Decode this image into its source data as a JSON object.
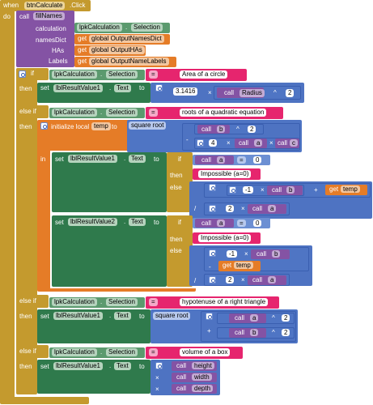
{
  "event": {
    "when": "when",
    "component": "btnCalculate",
    "event": ".Click",
    "do": "do"
  },
  "callFill": {
    "call": "call",
    "proc": "fillNames",
    "params": [
      "calculation",
      "namesDict",
      "HAs",
      "Labels"
    ],
    "calcComponent": "lpkCalculation",
    "calcProp": "Selection",
    "get": "get",
    "args": [
      "global OutputNamesDict",
      "global OutputHAs",
      "global OutputNameLabels"
    ]
  },
  "branches": {
    "if": "if",
    "elseif": "else if",
    "then": "then",
    "else": "else",
    "eq": "=",
    "times": "×",
    "plus": "+",
    "minus": "-",
    "div": "/",
    "pow": "^",
    "to": "to",
    "call": "call",
    "set": "set",
    "get": "get"
  },
  "b1": {
    "cmpComp": "lpkCalculation",
    "cmpProp": "Selection",
    "text": "Area of a circle",
    "target": "lblResultValue1",
    "targetProp": "Text",
    "pi": "3.1416",
    "radius": "Radius",
    "exp": "2"
  },
  "b2": {
    "cmpComp": "lpkCalculation",
    "cmpProp": "Selection",
    "text": "roots of a quadratic equation",
    "init": "initialize local",
    "varName": "temp",
    "to": "to",
    "sqrt": "square root",
    "b": "b",
    "two": "2",
    "four": "4",
    "a": "a",
    "c": "c",
    "in": "in",
    "target1": "lblResultValue1",
    "target2": "lblResultValue2",
    "prop": "Text",
    "zero": "0",
    "impossible": "Impossible (a=0)",
    "negOne": "-1",
    "temp": "temp"
  },
  "b3": {
    "cmpComp": "lpkCalculation",
    "cmpProp": "Selection",
    "text": "hypotenuse of a right triangle",
    "target": "lblResultValue1",
    "prop": "Text",
    "sqrt": "square root",
    "a": "a",
    "b": "b",
    "two": "2"
  },
  "b4": {
    "cmpComp": "lpkCalculation",
    "cmpProp": "Selection",
    "text": "volume of a box",
    "target": "lblResultValue1",
    "prop": "Text",
    "height": "height",
    "width": "width",
    "depth": "depth"
  }
}
